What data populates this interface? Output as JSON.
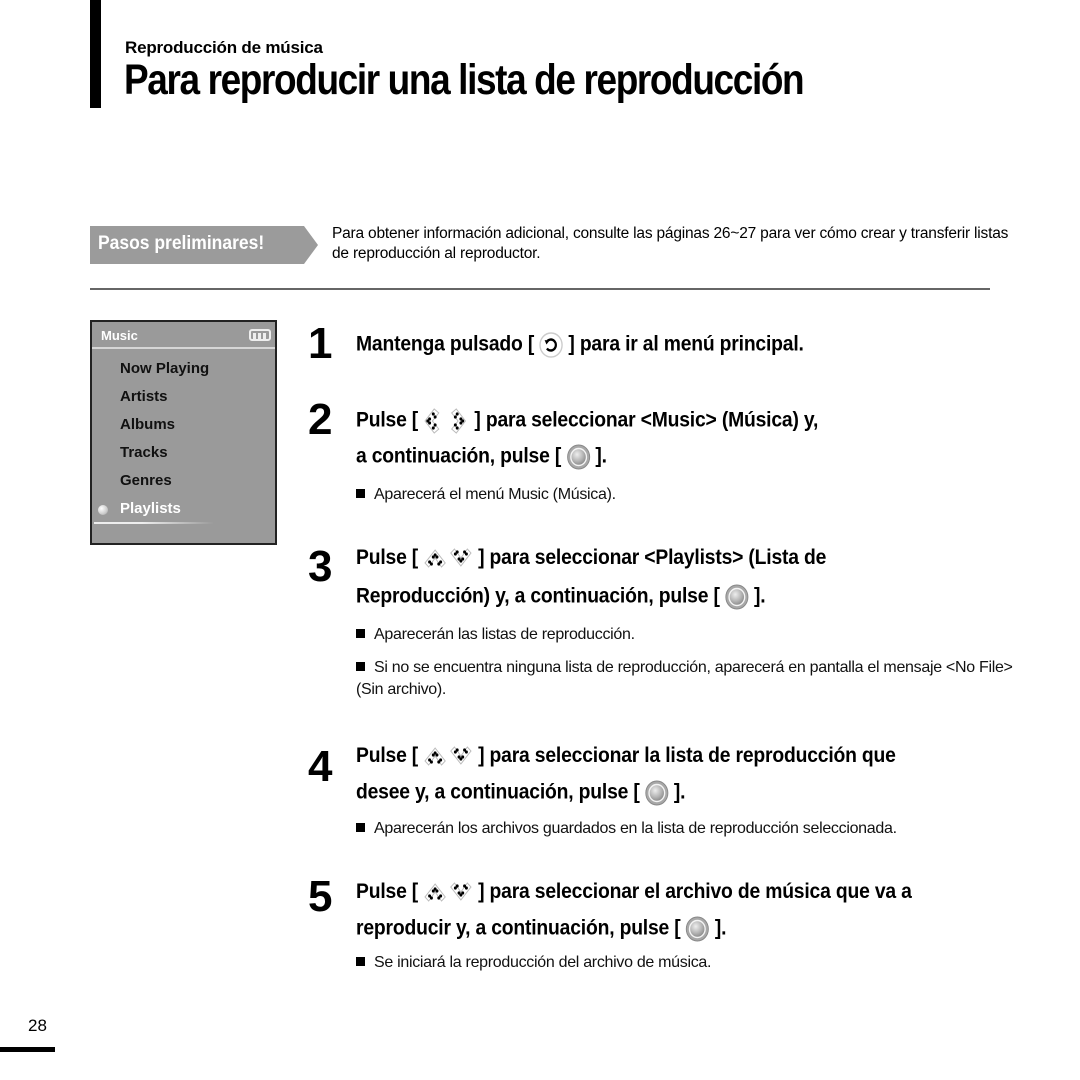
{
  "header": {
    "section": "Reproducción de música",
    "title": "Para reproducir una lista de reproducción"
  },
  "prelim": {
    "badge": "Pasos preliminares!",
    "text": "Para obtener información adicional, consulte las páginas 26~27 para ver cómo crear y transferir listas de reproducción al reproductor."
  },
  "device": {
    "title": "Music",
    "battery_icon": "battery-icon",
    "items": [
      {
        "label": "Now Playing",
        "selected": false
      },
      {
        "label": "Artists",
        "selected": false
      },
      {
        "label": "Albums",
        "selected": false
      },
      {
        "label": "Tracks",
        "selected": false
      },
      {
        "label": "Genres",
        "selected": false
      },
      {
        "label": "Playlists",
        "selected": true
      }
    ]
  },
  "steps": [
    {
      "number": "1",
      "lines": [
        {
          "pre": "Mantenga pulsado [",
          "icon": "back-button-icon",
          "post": "] para ir al menú principal."
        }
      ],
      "notes": []
    },
    {
      "number": "2",
      "lines": [
        {
          "pre": "Pulse [",
          "icon": "left-right-buttons-icon",
          "post": "] para seleccionar <Music> (Música) y,"
        },
        {
          "pre": "a continuación, pulse [",
          "icon": "select-button-icon",
          "post": "]."
        }
      ],
      "notes": [
        "Aparecerá el menú Music (Música)."
      ]
    },
    {
      "number": "3",
      "lines": [
        {
          "pre": "Pulse [",
          "icon": "up-down-buttons-icon",
          "post": "] para seleccionar <Playlists> (Lista de"
        },
        {
          "pre": "Reproducción) y, a continuación, pulse [",
          "icon": "select-button-icon",
          "post": "]."
        }
      ],
      "notes": [
        "Aparecerán las listas de reproducción.",
        "Si no se encuentra ninguna lista de reproducción, aparecerá en pantalla el mensaje <No File> (Sin archivo)."
      ]
    },
    {
      "number": "4",
      "lines": [
        {
          "pre": "Pulse [",
          "icon": "up-down-buttons-icon",
          "post": "] para seleccionar la lista de reproducción que"
        },
        {
          "pre": "desee y, a continuación, pulse [",
          "icon": "select-button-icon",
          "post": "]."
        }
      ],
      "notes": [
        "Aparecerán los archivos guardados en la lista de reproducción seleccionada."
      ]
    },
    {
      "number": "5",
      "lines": [
        {
          "pre": "Pulse [",
          "icon": "up-down-buttons-icon",
          "post": "] para seleccionar el archivo de música que va a"
        },
        {
          "pre": "reproducir y, a continuación, pulse [",
          "icon": "select-button-icon",
          "post": "]."
        }
      ],
      "notes": [
        "Se iniciará la reproducción del archivo de música."
      ]
    }
  ],
  "footer": {
    "page_number": "28"
  }
}
